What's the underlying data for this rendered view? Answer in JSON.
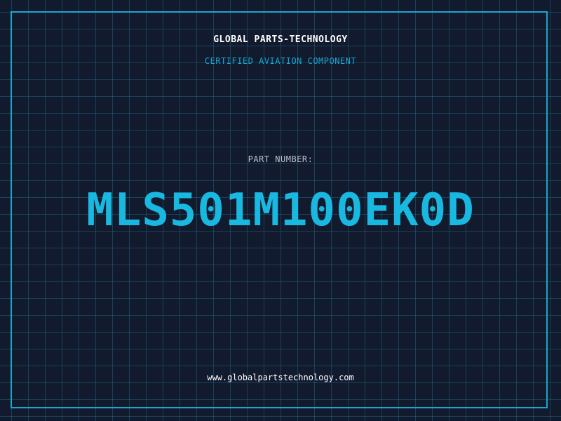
{
  "header": {
    "company": "GLOBAL PARTS-TECHNOLOGY",
    "tagline": "CERTIFIED AVIATION COMPONENT"
  },
  "part": {
    "label": "PART NUMBER:",
    "number": "MLS501M100EK0D"
  },
  "footer": {
    "website": "www.globalpartstechnology.com"
  },
  "colors": {
    "background": "#121a2e",
    "accent": "#1aa6cf",
    "part_number": "#19b8e0",
    "label": "#b8c1cc",
    "text": "#ffffff"
  }
}
